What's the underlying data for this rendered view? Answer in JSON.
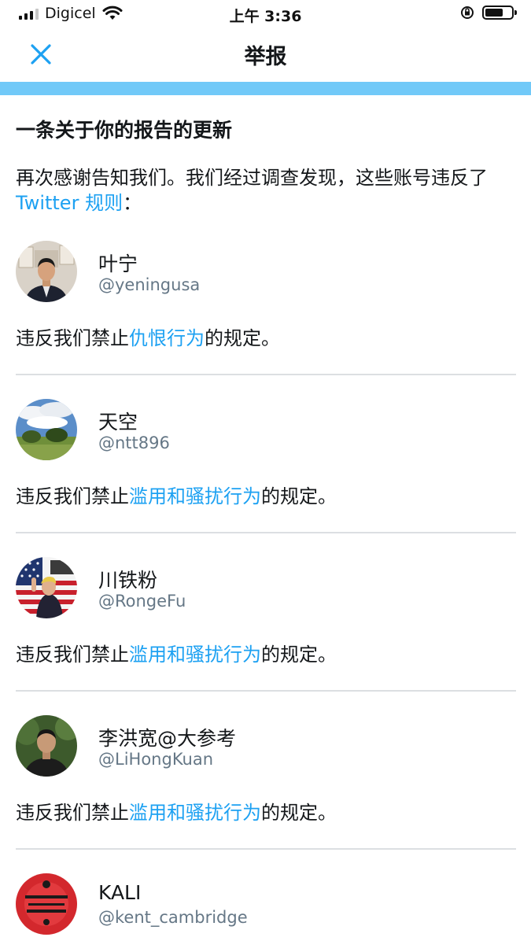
{
  "status_bar": {
    "carrier": "Digicel",
    "time": "上午 3:36"
  },
  "nav": {
    "title": "举报",
    "close_icon": "close-icon"
  },
  "colors": {
    "accent_bar": "#71c9f8",
    "link": "#1da1f2",
    "handle": "#657786"
  },
  "content": {
    "heading": "一条关于你的报告的更新",
    "intro_text": "再次感谢告知我们。我们经过调查发现，这些账号违反了 ",
    "intro_link": "Twitter 规则",
    "intro_end": "："
  },
  "accounts": [
    {
      "name": "叶宁",
      "handle": "@yeningusa",
      "prefix": "违反我们禁止",
      "rule": "仇恨行为",
      "suffix": "的规定。"
    },
    {
      "name": "天空",
      "handle": "@ntt896",
      "prefix": "违反我们禁止",
      "rule": "滥用和骚扰行为",
      "suffix": "的规定。"
    },
    {
      "name": "川铁粉",
      "handle": "@RongeFu",
      "prefix": "违反我们禁止",
      "rule": "滥用和骚扰行为",
      "suffix": "的规定。"
    },
    {
      "name": "李洪宽@大参考",
      "handle": "@LiHongKuan",
      "prefix": "违反我们禁止",
      "rule": "滥用和骚扰行为",
      "suffix": "的规定。"
    },
    {
      "name": "KALI",
      "handle": "@kent_cambridge"
    }
  ]
}
